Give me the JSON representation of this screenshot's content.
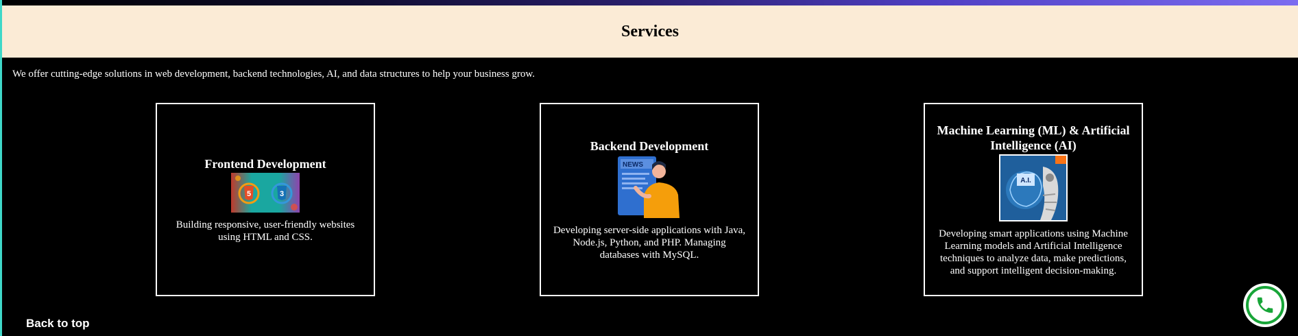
{
  "header": {
    "title": "Services"
  },
  "intro": {
    "text": "We offer cutting-edge solutions in web development, backend technologies, AI, and data structures to help your business grow."
  },
  "services": [
    {
      "title": "Frontend Development",
      "description": "Building responsive, user-friendly websites using HTML and CSS.",
      "image_icons": [
        "html5-icon",
        "css3-icon"
      ]
    },
    {
      "title": "Backend Development",
      "description": "Developing server-side applications with Java, Node.js, Python, and PHP. Managing databases with MySQL.",
      "image_label": "NEWS"
    },
    {
      "title": "Machine Learning (ML) & Artificial Intelligence (AI)",
      "description": "Developing smart applications using Machine Learning models and Artificial Intelligence techniques to analyze data, make predictions, and support intelligent decision-making.",
      "image_label": "A.I."
    }
  ],
  "footer": {
    "back_to_top": "Back to top"
  },
  "floating": {
    "icon": "phone-icon"
  },
  "colors": {
    "header_bg": "#fbebd6",
    "page_bg": "#000000",
    "phone_green": "#18a538",
    "accent_teal": "#3fd8c8"
  }
}
